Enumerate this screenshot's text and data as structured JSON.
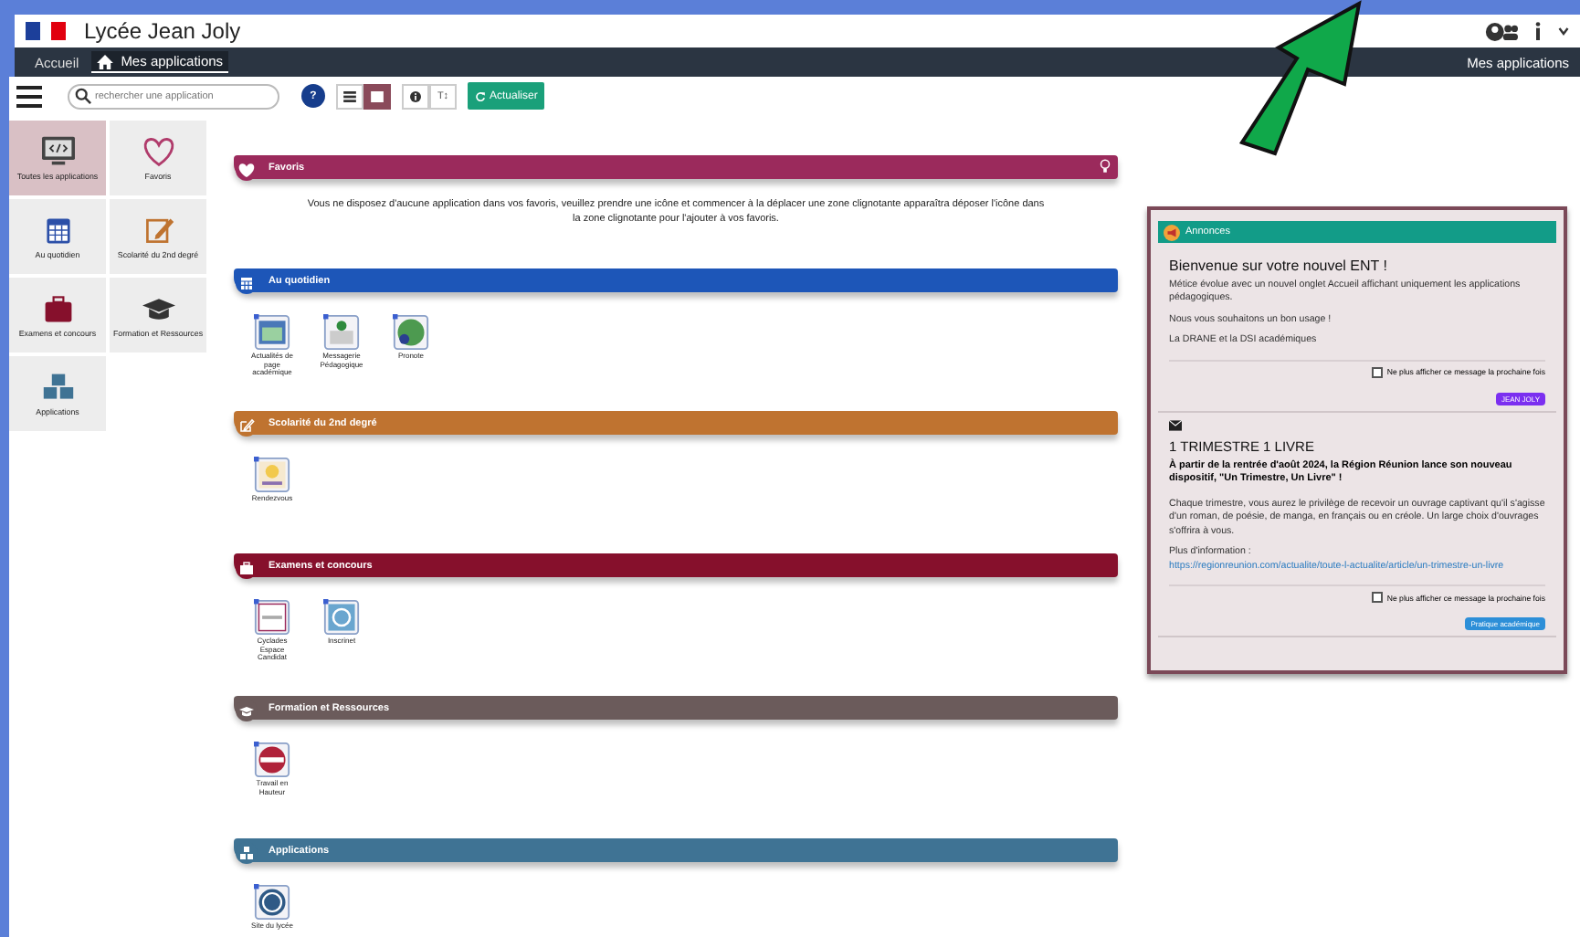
{
  "header": {
    "title": "Lycée Jean Joly"
  },
  "nav": {
    "tabs": [
      {
        "label": "Accueil",
        "selected": false
      },
      {
        "label": "Mes applications",
        "selected": true
      }
    ],
    "right_label": "Mes applications"
  },
  "toolbar": {
    "search": {
      "placeholder": "rechercher une application"
    },
    "help": "?",
    "views": [
      {
        "kind": "list",
        "selected": false
      },
      {
        "kind": "grid",
        "selected": true
      }
    ],
    "text_size": "T↕",
    "refresh": "Actualiser"
  },
  "sidebar": {
    "items": [
      {
        "label": "Toutes les applications",
        "kind": "monitor",
        "selected": true
      },
      {
        "label": "Favoris",
        "kind": "heart",
        "selected": false
      },
      {
        "label": "Au quotidien",
        "kind": "calendar",
        "selected": false
      },
      {
        "label": "Scolarité du 2nd degré",
        "kind": "pencil",
        "selected": false
      },
      {
        "label": "Examens et concours",
        "kind": "briefcase",
        "selected": false
      },
      {
        "label": "Formation et Ressources",
        "kind": "cap",
        "selected": false
      },
      {
        "label": "Applications",
        "kind": "cubes",
        "selected": false
      }
    ]
  },
  "sections": [
    {
      "title": "Favoris",
      "kind": "heart",
      "color": "#9b2a5c",
      "message": "Vous ne disposez d'aucune application dans vos favoris, veuillez prendre une icône et commencer à la déplacer une zone clignotante apparaîtra déposer l'icône dans la zone clignotante pour l'ajouter à vos favoris."
    },
    {
      "title": "Au quotidien",
      "kind": "calendar",
      "color": "#1d56b8",
      "apps": [
        {
          "label": "Actualités de page académique",
          "kind": "page"
        },
        {
          "label": "Messagerie Pédagogique",
          "kind": "mail"
        },
        {
          "label": "Pronote",
          "kind": "globe"
        }
      ]
    },
    {
      "title": "Scolarité du 2nd degré",
      "kind": "pencil",
      "color": "#bf7330",
      "apps": [
        {
          "label": "Rendezvous",
          "kind": "bulb"
        }
      ]
    },
    {
      "title": "Examens et concours",
      "kind": "briefcase",
      "color": "#86102c",
      "apps": [
        {
          "label": "Cyclades Espace Candidat",
          "kind": "text"
        },
        {
          "label": "Inscrinet",
          "kind": "at"
        }
      ]
    },
    {
      "title": "Formation et Ressources",
      "kind": "cap",
      "color": "#6b5b5b",
      "apps": [
        {
          "label": "Travail en Hauteur",
          "kind": "seal"
        }
      ]
    },
    {
      "title": "Applications",
      "kind": "cubes",
      "color": "#3f7394",
      "apps": [
        {
          "label": "Site du lycée",
          "kind": "wordpress"
        }
      ]
    }
  ],
  "announcements": {
    "title": "Annonces",
    "cards": [
      {
        "kind": "info",
        "title": "Bienvenue sur votre nouvel ENT !",
        "paragraphs": [
          "Métice évolue avec un nouvel onglet Accueil affichant uniquement les applications pédagogiques.",
          "Nous vous souhaitons un bon usage !",
          "La DRANE et la DSI académiques"
        ],
        "hide_label": "Ne plus afficher ce message la prochaine fois",
        "hide_checked": false,
        "tag": "JEAN JOLY",
        "color": "#7b2ff0"
      },
      {
        "kind": "mail",
        "title": "1 TRIMESTRE 1 LIVRE",
        "lead": "À partir de la rentrée d'août 2024, la Région Réunion lance son nouveau dispositif, \"Un Trimestre, Un Livre\" !",
        "paragraphs": [
          "Chaque trimestre, vous aurez le privilège de recevoir un ouvrage captivant qu'il s'agisse d'un roman, de poésie, de manga, en français ou en créole. Un large choix d'ouvrages s'offrira à vous."
        ],
        "more_label": "Plus d'information :",
        "link": "https://regionreunion.com/actualite/toute-l-actualite/article/un-trimestre-un-livre",
        "hide_label": "Ne plus afficher ce message la prochaine fois",
        "hide_checked": false,
        "tag": "Pratique académique",
        "color": "#2d8fd8"
      }
    ]
  }
}
